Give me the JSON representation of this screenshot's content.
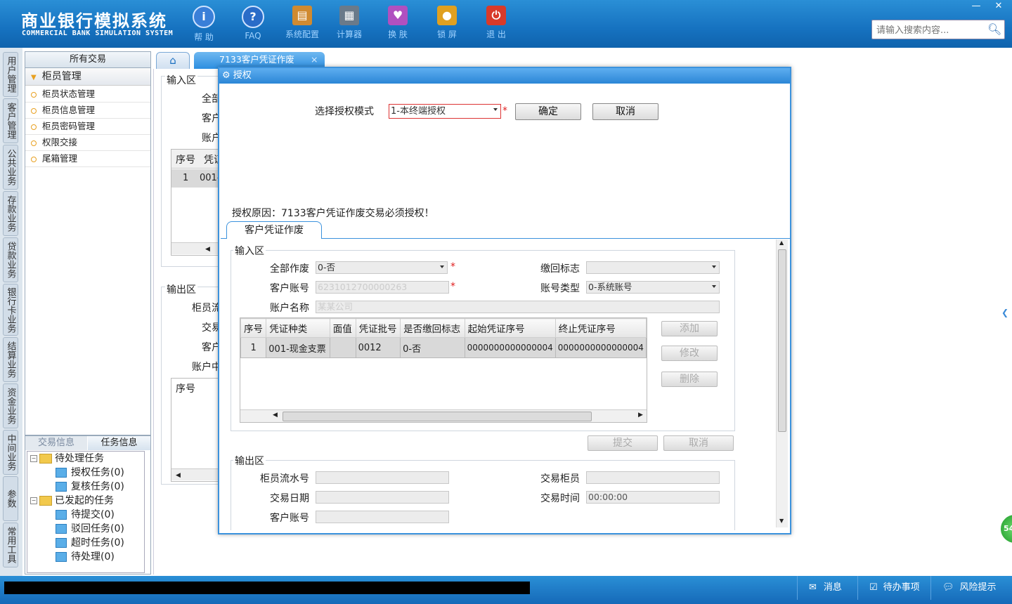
{
  "app": {
    "title": "商业银行模拟系统",
    "subtitle": "COMMERCIAL BANK SIMULATION SYSTEM"
  },
  "toolbar": {
    "items": [
      {
        "label": "帮 助",
        "icon": "info-icon",
        "glyph": "i",
        "color": "#3a7fd8"
      },
      {
        "label": "FAQ",
        "icon": "question-icon",
        "glyph": "?",
        "color": "#2a6cc8"
      },
      {
        "label": "系统配置",
        "icon": "toolbox-icon",
        "glyph": "▤",
        "color": "#d08a30"
      },
      {
        "label": "计算器",
        "icon": "calculator-icon",
        "glyph": "▦",
        "color": "#6a7a8a"
      },
      {
        "label": "换 肤",
        "icon": "shirt-icon",
        "glyph": "♥",
        "color": "#b050c0"
      },
      {
        "label": "锁 屏",
        "icon": "lock-icon",
        "glyph": "●",
        "color": "#e0a020"
      },
      {
        "label": "退 出",
        "icon": "power-icon",
        "glyph": "⏻",
        "color": "#d83a2a"
      }
    ]
  },
  "window_controls": {
    "minimize": "—",
    "close": "✕"
  },
  "search": {
    "placeholder": "请输入搜索内容..."
  },
  "vtabs": [
    "用户管理",
    "客户管理",
    "公共业务",
    "存款业务",
    "贷款业务",
    "银行卡业务",
    "结算业务",
    "资金业务",
    "中间业务",
    "参数",
    "常用工具"
  ],
  "left_panel": {
    "header": "所有交易",
    "group": "柜员管理",
    "items": [
      "柜员状态管理",
      "柜员信息管理",
      "柜员密码管理",
      "权限交接",
      "尾箱管理"
    ]
  },
  "task_panel": {
    "tabs": [
      "交易信息",
      "任务信息"
    ],
    "pending": {
      "label": "待处理任务",
      "children": [
        "授权任务(0)",
        "复核任务(0)"
      ]
    },
    "initiated": {
      "label": "已发起的任务",
      "children": [
        "待提交(0)",
        "驳回任务(0)",
        "超时任务(0)",
        "待处理(0)"
      ]
    }
  },
  "tabs": {
    "active": "7133客户凭证作废",
    "close": "×"
  },
  "background": {
    "input_area": "输入区",
    "labels": [
      "全部",
      "客户",
      "账户"
    ],
    "col_seq": "序号",
    "col_voucher": "凭证",
    "row_seq": "1",
    "row_val": "001-",
    "output_area": "输出区",
    "out_labels": [
      "柜员流",
      "交易",
      "客户",
      "账户中"
    ],
    "seq2": "序号"
  },
  "modal": {
    "title": "授权",
    "auth_mode_label": "选择授权模式",
    "auth_mode_value": "1-本终端授权",
    "required_mark": "*",
    "confirm": "确定",
    "cancel": "取消",
    "reason": "授权原因：7133客户凭证作废交易必须授权！",
    "inner_tab": "客户凭证作废",
    "input_area": "输入区",
    "fields": {
      "all_void_label": "全部作废",
      "all_void_value": "0-否",
      "recall_label": "缴回标志",
      "recall_value": "",
      "account_label": "客户账号",
      "account_value": "6231012700000263",
      "account_type_label": "账号类型",
      "account_type_value": "0-系统账号",
      "account_name_label": "账户名称",
      "account_name_value": "某某公司"
    },
    "grid": {
      "headers": [
        "序号",
        "凭证种类",
        "面值",
        "凭证批号",
        "是否缴回标志",
        "起始凭证序号",
        "终止凭证序号"
      ],
      "rows": [
        [
          "1",
          "001-现金支票",
          "",
          "0012",
          "0-否",
          "0000000000000004",
          "0000000000000004"
        ]
      ]
    },
    "side_buttons": [
      "添加",
      "修改",
      "删除"
    ],
    "submit": "提交",
    "cancel2": "取消",
    "output_area": "输出区",
    "output": {
      "serial_label": "柜员流水号",
      "teller_label": "交易柜员",
      "date_label": "交易日期",
      "time_label": "交易时间",
      "time_value": "00:00:00",
      "account_label": "客户账号"
    }
  },
  "statusbar": {
    "message": "消息",
    "todo": "待办事项",
    "risk": "风险提示",
    "badge": "54"
  }
}
